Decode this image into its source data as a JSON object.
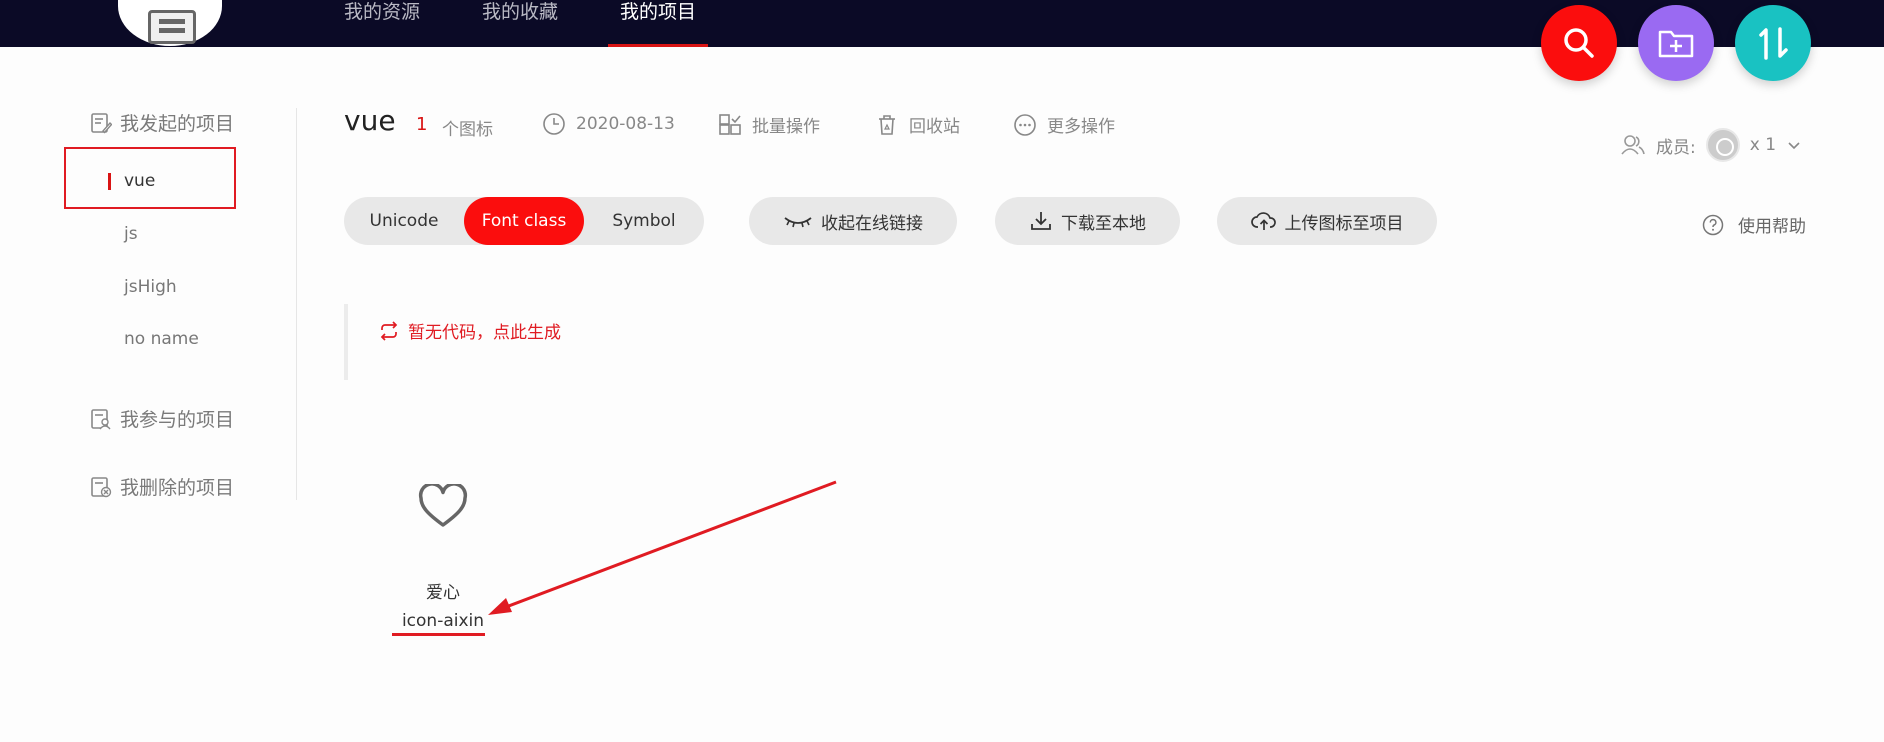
{
  "nav": {
    "tabs": [
      {
        "label": "我的资源"
      },
      {
        "label": "我的收藏"
      },
      {
        "label": "我的项目",
        "active": true
      }
    ]
  },
  "actions": {
    "search": {
      "icon": "search-icon",
      "color": "#fb0d0d"
    },
    "new_project": {
      "icon": "folder-plus-icon",
      "color": "#9a6af2"
    },
    "sort": {
      "icon": "sort-icon",
      "color": "#19c2c2"
    }
  },
  "sidebar": {
    "my_projects_heading": "我发起的项目",
    "projects": [
      {
        "label": "vue",
        "active": true
      },
      {
        "label": "js"
      },
      {
        "label": "jsHigh"
      },
      {
        "label": "no name"
      }
    ],
    "joined_heading": "我参与的项目",
    "deleted_heading": "我删除的项目"
  },
  "project": {
    "title": "vue",
    "icon_count": "1",
    "icon_count_label": "个图标",
    "date": "2020-08-13",
    "batch_label": "批量操作",
    "recycle_label": "回收站",
    "more_label": "更多操作",
    "members_label": "成员:",
    "members_count": "x 1"
  },
  "toolbar": {
    "tabs": [
      {
        "label": "Unicode"
      },
      {
        "label": "Font class",
        "active": true
      },
      {
        "label": "Symbol"
      }
    ],
    "collapse_link_label": "收起在线链接",
    "download_label": "下载至本地",
    "upload_label": "上传图标至项目",
    "help_label": "使用帮助"
  },
  "code": {
    "generate_label": "暂无代码，点此生成"
  },
  "icons": [
    {
      "name": "爱心",
      "code": "icon-aixin",
      "icon": "heart-icon"
    }
  ],
  "colors": {
    "accent": "#e01b22",
    "topbar": "#0b0a26"
  }
}
